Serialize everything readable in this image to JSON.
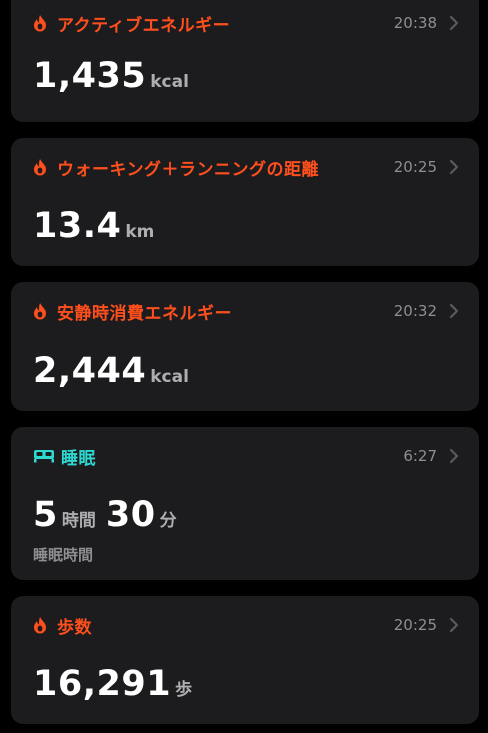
{
  "colors": {
    "accent_orange": "#ff4f1d",
    "accent_cyan": "#2ed9d1",
    "card_bg": "#1c1c1e",
    "muted": "#8e8e93"
  },
  "cards": [
    {
      "icon": "flame-icon",
      "title": "アクティブエネルギー",
      "time": "20:38",
      "value": "1,435",
      "unit": "kcal"
    },
    {
      "icon": "flame-icon",
      "title": "ウォーキング＋ランニングの距離",
      "time": "20:25",
      "value": "13.4",
      "unit": "km"
    },
    {
      "icon": "flame-icon",
      "title": "安静時消費エネルギー",
      "time": "20:32",
      "value": "2,444",
      "unit": "kcal"
    },
    {
      "icon": "bed-icon",
      "title": "睡眠",
      "time": "6:27",
      "hours": "5",
      "hours_unit": "時間",
      "minutes": "30",
      "minutes_unit": "分",
      "sublabel": "睡眠時間"
    },
    {
      "icon": "flame-icon",
      "title": "歩数",
      "time": "20:25",
      "value": "16,291",
      "unit": "歩"
    }
  ]
}
